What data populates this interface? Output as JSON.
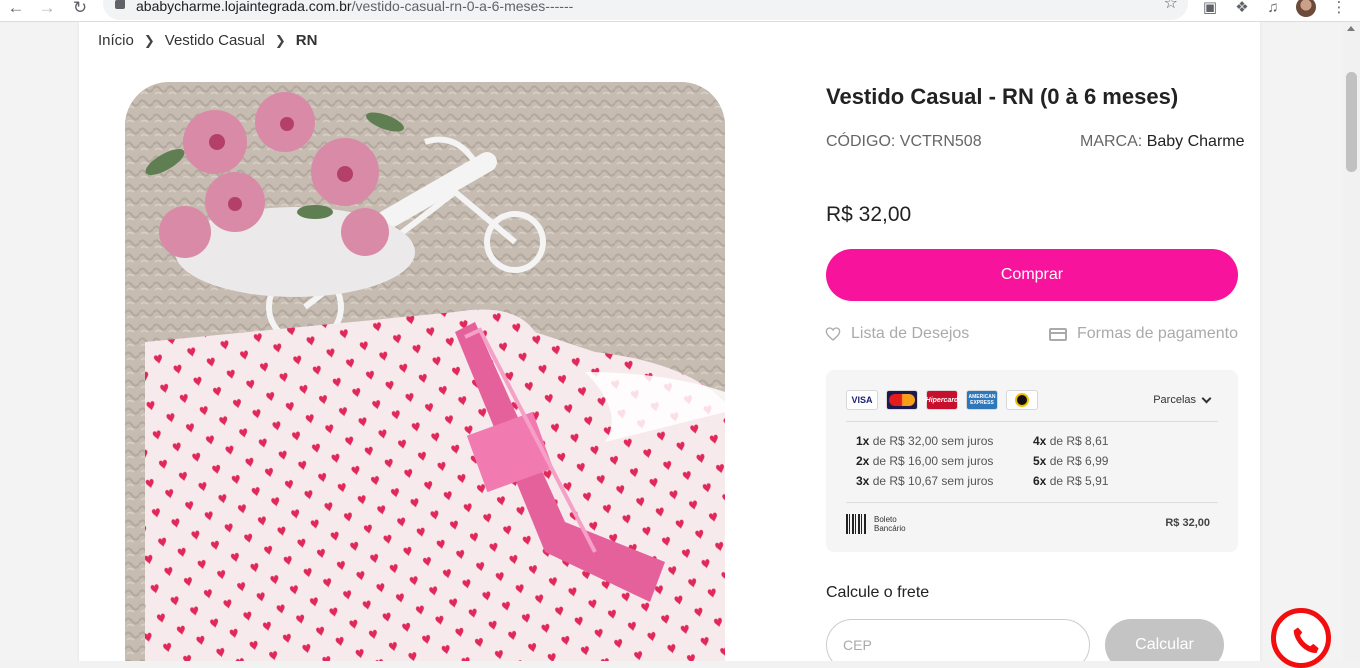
{
  "browser": {
    "url_host": "ababycharme.lojaintegrada.com.br",
    "url_path": "/vestido-casual-rn-0-a-6-meses------"
  },
  "breadcrumb": [
    {
      "label": "Início"
    },
    {
      "label": "Vestido Casual"
    },
    {
      "label": "RN"
    }
  ],
  "product": {
    "title": "Vestido Casual - RN (0 à 6 meses)",
    "code_label": "CÓDIGO: VCTRN508",
    "brand_label": "MARCA:",
    "brand_value": "Baby Charme",
    "price": "R$ 32,00",
    "buy_label": "Comprar",
    "wishlist_label": "Lista de Desejos",
    "payment_forms_label": "Formas de pagamento"
  },
  "payment": {
    "flags": [
      "VISA",
      "Mastercard",
      "Hipercard",
      "American Express",
      "elo"
    ],
    "installments_toggle": "Parcelas",
    "installments": [
      {
        "n": "1x",
        "text": "de R$ 32,00 sem juros"
      },
      {
        "n": "2x",
        "text": "de R$ 16,00 sem juros"
      },
      {
        "n": "3x",
        "text": "de R$ 10,67 sem juros"
      },
      {
        "n": "4x",
        "text": "de R$ 8,61"
      },
      {
        "n": "5x",
        "text": "de R$ 6,99"
      },
      {
        "n": "6x",
        "text": "de R$ 5,91"
      }
    ],
    "boleto_label_1": "Boleto",
    "boleto_label_2": "Bancário",
    "boleto_price": "R$ 32,00"
  },
  "shipping": {
    "label": "Calcule o frete",
    "cep_placeholder": "CEP",
    "calc_label": "Calcular"
  },
  "colors": {
    "accent": "#f7139b",
    "whatsapp_ring": "#f20e0e"
  }
}
